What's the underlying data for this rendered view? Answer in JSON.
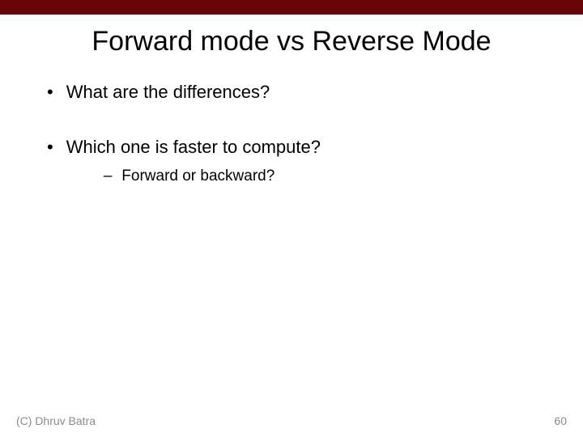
{
  "topbar_color": "#690708",
  "title": "Forward mode vs Reverse Mode",
  "bullets": [
    {
      "text": "What are the differences?",
      "sub": []
    },
    {
      "text": "Which one is faster to compute?",
      "sub": [
        "Forward or backward?"
      ]
    }
  ],
  "footer": {
    "left": "(C) Dhruv Batra",
    "right": "60"
  }
}
